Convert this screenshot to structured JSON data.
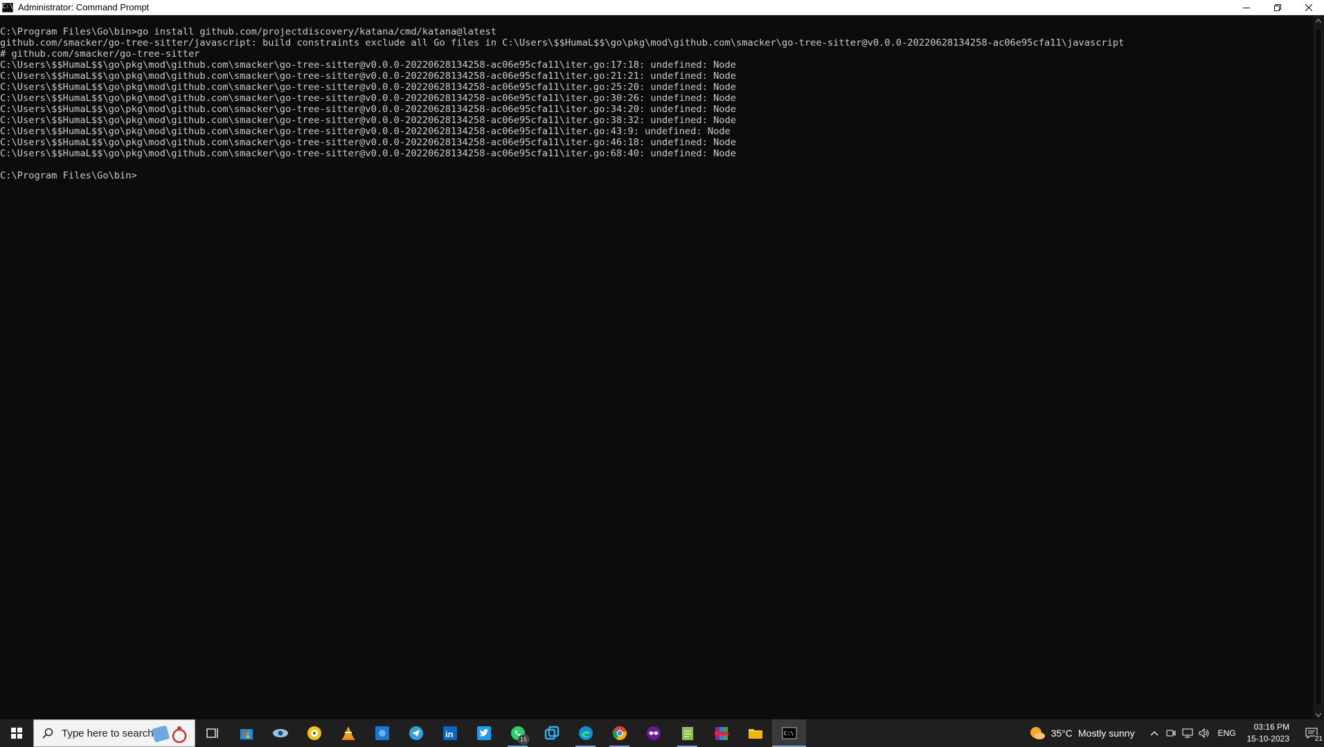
{
  "window": {
    "title": "Administrator: Command Prompt",
    "icon_text": "C:\\"
  },
  "console": {
    "lines": [
      "C:\\Program Files\\Go\\bin>go install github.com/projectdiscovery/katana/cmd/katana@latest",
      "github.com/smacker/go-tree-sitter/javascript: build constraints exclude all Go files in C:\\Users\\$$HumaL$$\\go\\pkg\\mod\\github.com\\smacker\\go-tree-sitter@v0.0.0-20220628134258-ac06e95cfa11\\javascript",
      "# github.com/smacker/go-tree-sitter",
      "C:\\Users\\$$HumaL$$\\go\\pkg\\mod\\github.com\\smacker\\go-tree-sitter@v0.0.0-20220628134258-ac06e95cfa11\\iter.go:17:18: undefined: Node",
      "C:\\Users\\$$HumaL$$\\go\\pkg\\mod\\github.com\\smacker\\go-tree-sitter@v0.0.0-20220628134258-ac06e95cfa11\\iter.go:21:21: undefined: Node",
      "C:\\Users\\$$HumaL$$\\go\\pkg\\mod\\github.com\\smacker\\go-tree-sitter@v0.0.0-20220628134258-ac06e95cfa11\\iter.go:25:20: undefined: Node",
      "C:\\Users\\$$HumaL$$\\go\\pkg\\mod\\github.com\\smacker\\go-tree-sitter@v0.0.0-20220628134258-ac06e95cfa11\\iter.go:30:26: undefined: Node",
      "C:\\Users\\$$HumaL$$\\go\\pkg\\mod\\github.com\\smacker\\go-tree-sitter@v0.0.0-20220628134258-ac06e95cfa11\\iter.go:34:20: undefined: Node",
      "C:\\Users\\$$HumaL$$\\go\\pkg\\mod\\github.com\\smacker\\go-tree-sitter@v0.0.0-20220628134258-ac06e95cfa11\\iter.go:38:32: undefined: Node",
      "C:\\Users\\$$HumaL$$\\go\\pkg\\mod\\github.com\\smacker\\go-tree-sitter@v0.0.0-20220628134258-ac06e95cfa11\\iter.go:43:9: undefined: Node",
      "C:\\Users\\$$HumaL$$\\go\\pkg\\mod\\github.com\\smacker\\go-tree-sitter@v0.0.0-20220628134258-ac06e95cfa11\\iter.go:46:18: undefined: Node",
      "C:\\Users\\$$HumaL$$\\go\\pkg\\mod\\github.com\\smacker\\go-tree-sitter@v0.0.0-20220628134258-ac06e95cfa11\\iter.go:68:40: undefined: Node",
      "",
      "C:\\Program Files\\Go\\bin>"
    ]
  },
  "taskbar": {
    "search_placeholder": "Type here to search",
    "apps": [
      {
        "name": "task-view-icon"
      },
      {
        "name": "microsoft-store-icon"
      },
      {
        "name": "eye-app-icon"
      },
      {
        "name": "media-disc-icon"
      },
      {
        "name": "vlc-icon"
      },
      {
        "name": "blue-app-icon"
      },
      {
        "name": "telegram-icon"
      },
      {
        "name": "linkedin-icon"
      },
      {
        "name": "twitter-icon"
      },
      {
        "name": "whatsapp-icon",
        "badge": "15"
      },
      {
        "name": "window-switch-icon"
      },
      {
        "name": "edge-icon"
      },
      {
        "name": "chrome-icon"
      },
      {
        "name": "mask-app-icon"
      },
      {
        "name": "notepad-icon"
      },
      {
        "name": "winrar-icon"
      },
      {
        "name": "file-explorer-icon"
      },
      {
        "name": "command-prompt-icon"
      }
    ],
    "weather": {
      "temp": "35°C",
      "condition": "Mostly sunny"
    },
    "language": "ENG",
    "clock": {
      "time": "03:16 PM",
      "date": "15-10-2023"
    },
    "notifications_count": "21"
  },
  "colors": {
    "console_bg": "#0c0c0c",
    "console_text": "#cccccc",
    "taskbar_bg": "#1f1f1f",
    "accent": "#7aa7d6"
  }
}
